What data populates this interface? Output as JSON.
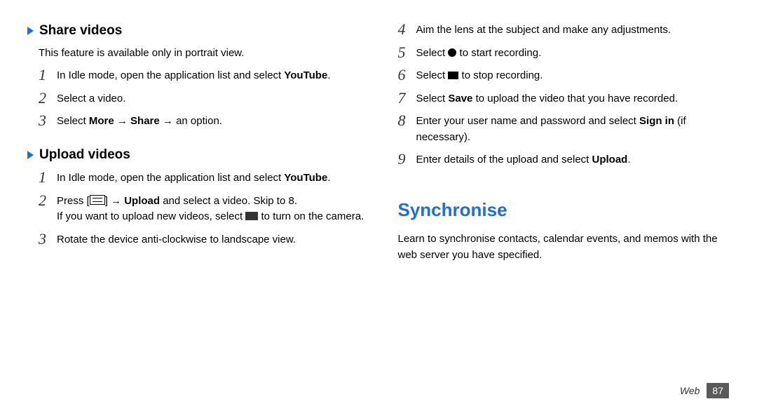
{
  "sections": {
    "share": {
      "heading": "Share videos",
      "note": "This feature is available only in portrait view.",
      "steps": {
        "1a": "In Idle mode, open the application list and select ",
        "1b": "YouTube",
        "1c": ".",
        "2": "Select a video.",
        "3a": "Select ",
        "3b": "More",
        "3c": " → ",
        "3d": "Share",
        "3e": " → an option."
      }
    },
    "upload": {
      "heading": "Upload videos",
      "steps": {
        "1a": "In Idle mode, open the application list and select ",
        "1b": "YouTube",
        "1c": ".",
        "2a": "Press [",
        "2b": "] → ",
        "2c": "Upload",
        "2d": " and select a video. Skip to 8.",
        "2e": "If you want to upload new videos, select ",
        "2f": " to turn on the camera.",
        "3": "Rotate the device anti-clockwise to landscape view."
      }
    },
    "right": {
      "steps": {
        "4": "Aim the lens at the subject and make any adjustments.",
        "5a": "Select ",
        "5b": " to start recording.",
        "6a": "Select ",
        "6b": " to stop recording.",
        "7a": "Select ",
        "7b": "Save",
        "7c": " to upload the video that you have recorded.",
        "8a": "Enter your user name and password and select ",
        "8b": "Sign in",
        "8c": " (if necessary).",
        "9a": "Enter details of the upload and select ",
        "9b": "Upload",
        "9c": "."
      }
    },
    "sync": {
      "heading": "Synchronise",
      "lead": "Learn to synchronise contacts, calendar events, and memos with the web server you have specified."
    }
  },
  "nums": {
    "n1": "1",
    "n2": "2",
    "n3": "3",
    "n4": "4",
    "n5": "5",
    "n6": "6",
    "n7": "7",
    "n8": "8",
    "n9": "9"
  },
  "footer": {
    "category": "Web",
    "page": "87"
  }
}
